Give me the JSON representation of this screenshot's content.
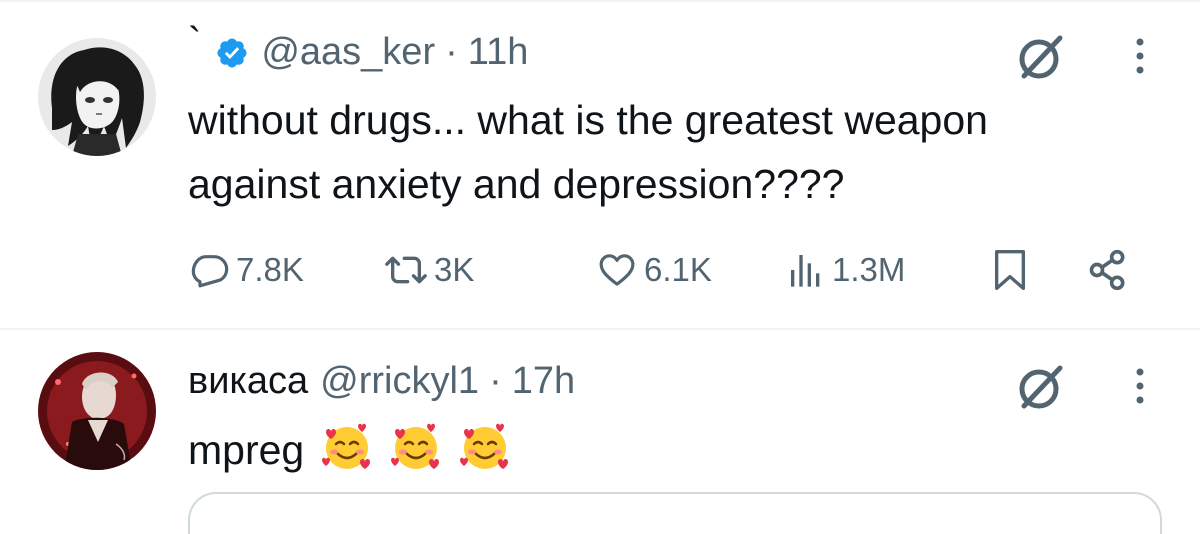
{
  "colors": {
    "text_primary": "#0f1419",
    "text_secondary": "#536471",
    "verified_blue": "#1d9bf0",
    "divider": "#eff3f4",
    "background": "#ffffff"
  },
  "tweets": [
    {
      "display_name": "`",
      "verified": true,
      "handle": "@aas_ker",
      "separator": "·",
      "time": "11h",
      "text_line_1": "without drugs... what is the greatest weapon",
      "text_line_2": "against anxiety and depression????",
      "avatar_icon": "avatar-dark-hair-anime",
      "actions": {
        "reply_icon": "reply-icon",
        "reply_count": "7.8K",
        "retweet_icon": "retweet-icon",
        "retweet_count": "3K",
        "like_icon": "heart-icon",
        "like_count": "6.1K",
        "views_icon": "views-chart-icon",
        "views_count": "1.3M",
        "bookmark_icon": "bookmark-icon",
        "share_icon": "share-icon"
      }
    },
    {
      "display_name": "викаса",
      "verified": false,
      "handle": "@rrickyl1",
      "separator": "·",
      "time": "17h",
      "text": "mpreg",
      "emojis": [
        "smiling-face-with-hearts",
        "smiling-face-with-hearts",
        "smiling-face-with-hearts"
      ],
      "avatar_icon": "avatar-red-anime"
    }
  ]
}
